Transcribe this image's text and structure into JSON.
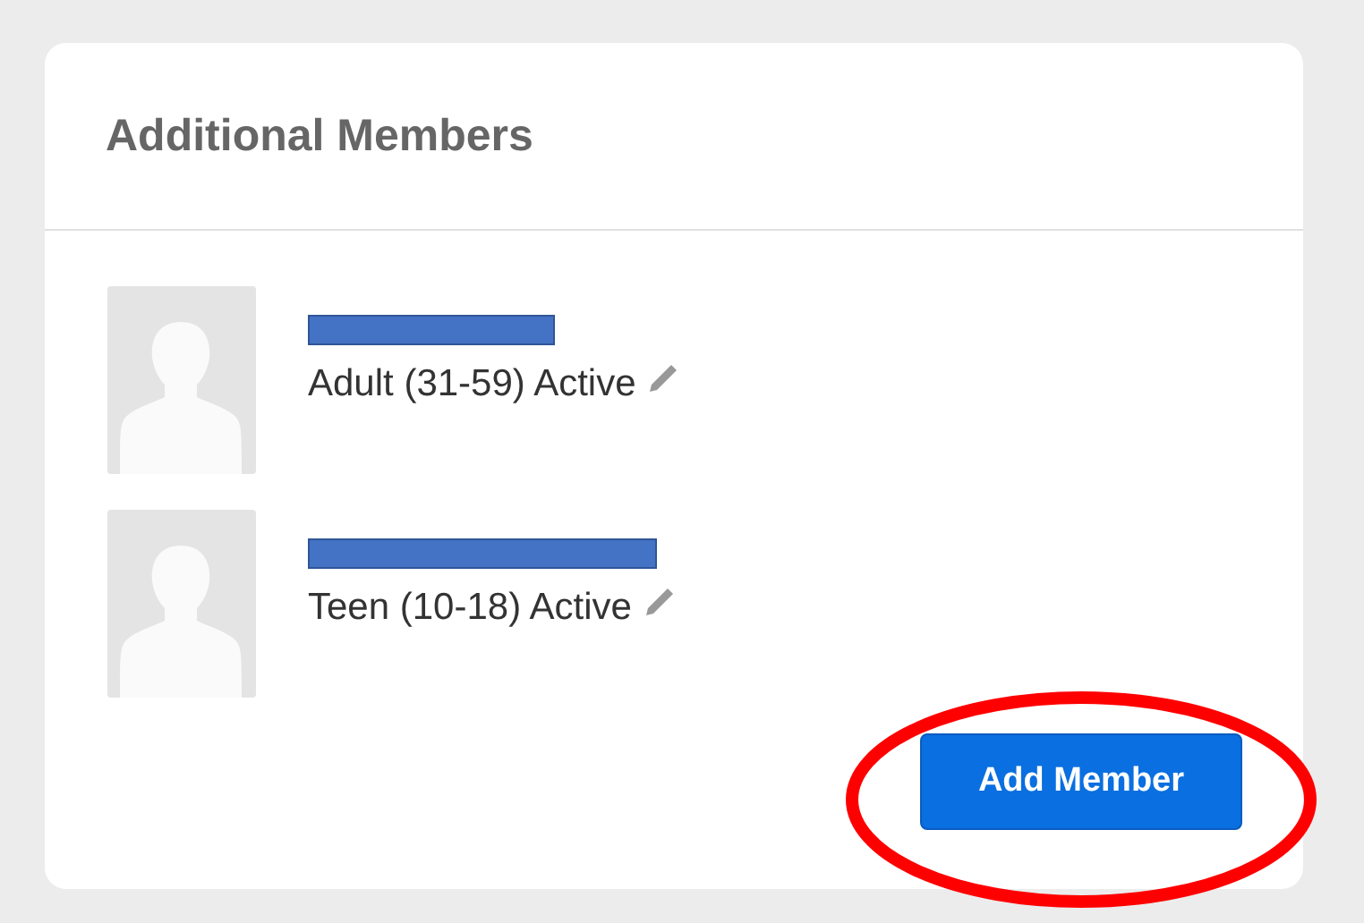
{
  "card": {
    "title": "Additional Members"
  },
  "members": [
    {
      "name_redacted": true,
      "status": "Adult (31-59) Active"
    },
    {
      "name_redacted": true,
      "status": "Teen (10-18) Active"
    }
  ],
  "add_button": {
    "label": "Add Member",
    "highlighted": true
  }
}
